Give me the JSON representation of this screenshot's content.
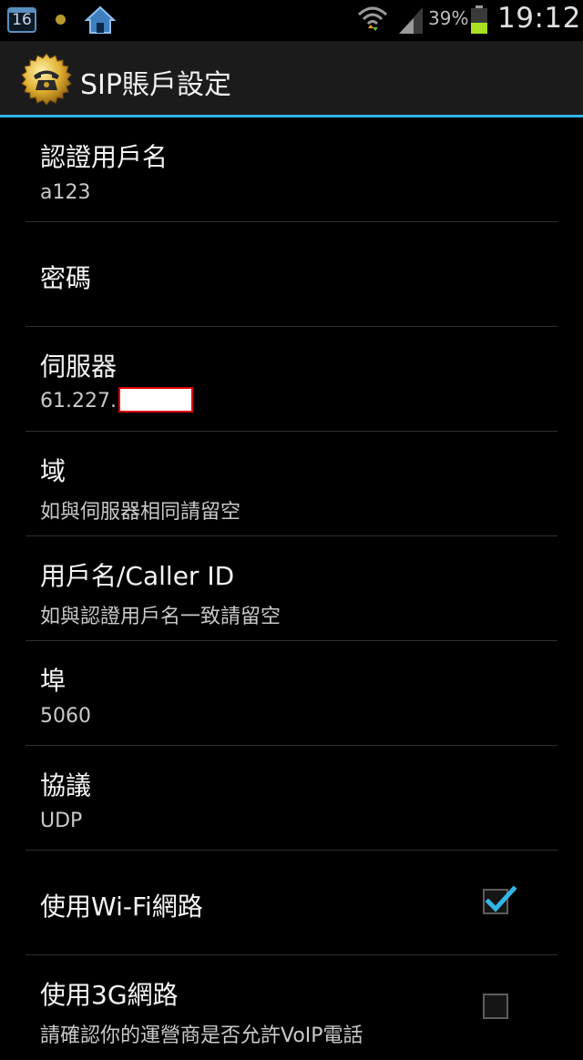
{
  "status_bar": {
    "calendar_day": "16",
    "battery_percent": "39%",
    "time": "19:12",
    "icons": [
      "calendar-icon",
      "notification-dot-icon",
      "home-icon",
      "wifi-icon",
      "signal-icon",
      "battery-icon"
    ]
  },
  "title_bar": {
    "title": "SIP賬戶設定",
    "icon": "phone-seal-icon"
  },
  "colors": {
    "accent": "#33b5e5",
    "background": "#000000",
    "title_bar": "#1b1b1b",
    "redaction_border": "#e00000"
  },
  "preferences": [
    {
      "title": "認證用戶名",
      "summary": "a123"
    },
    {
      "title": "密碼",
      "summary": ""
    },
    {
      "title": "伺服器",
      "summary": "61.227."
    },
    {
      "title": "域",
      "summary": "如與伺服器相同請留空"
    },
    {
      "title": "用戶名/Caller ID",
      "summary": "如與認證用戶名一致請留空"
    },
    {
      "title": "埠",
      "summary": "5060"
    },
    {
      "title": "協議",
      "summary": "UDP"
    },
    {
      "title": "使用Wi-Fi網路",
      "checked": true
    },
    {
      "title": "使用3G網路",
      "summary": "請確認你的運營商是否允許VoIP電話",
      "checked": false
    }
  ]
}
